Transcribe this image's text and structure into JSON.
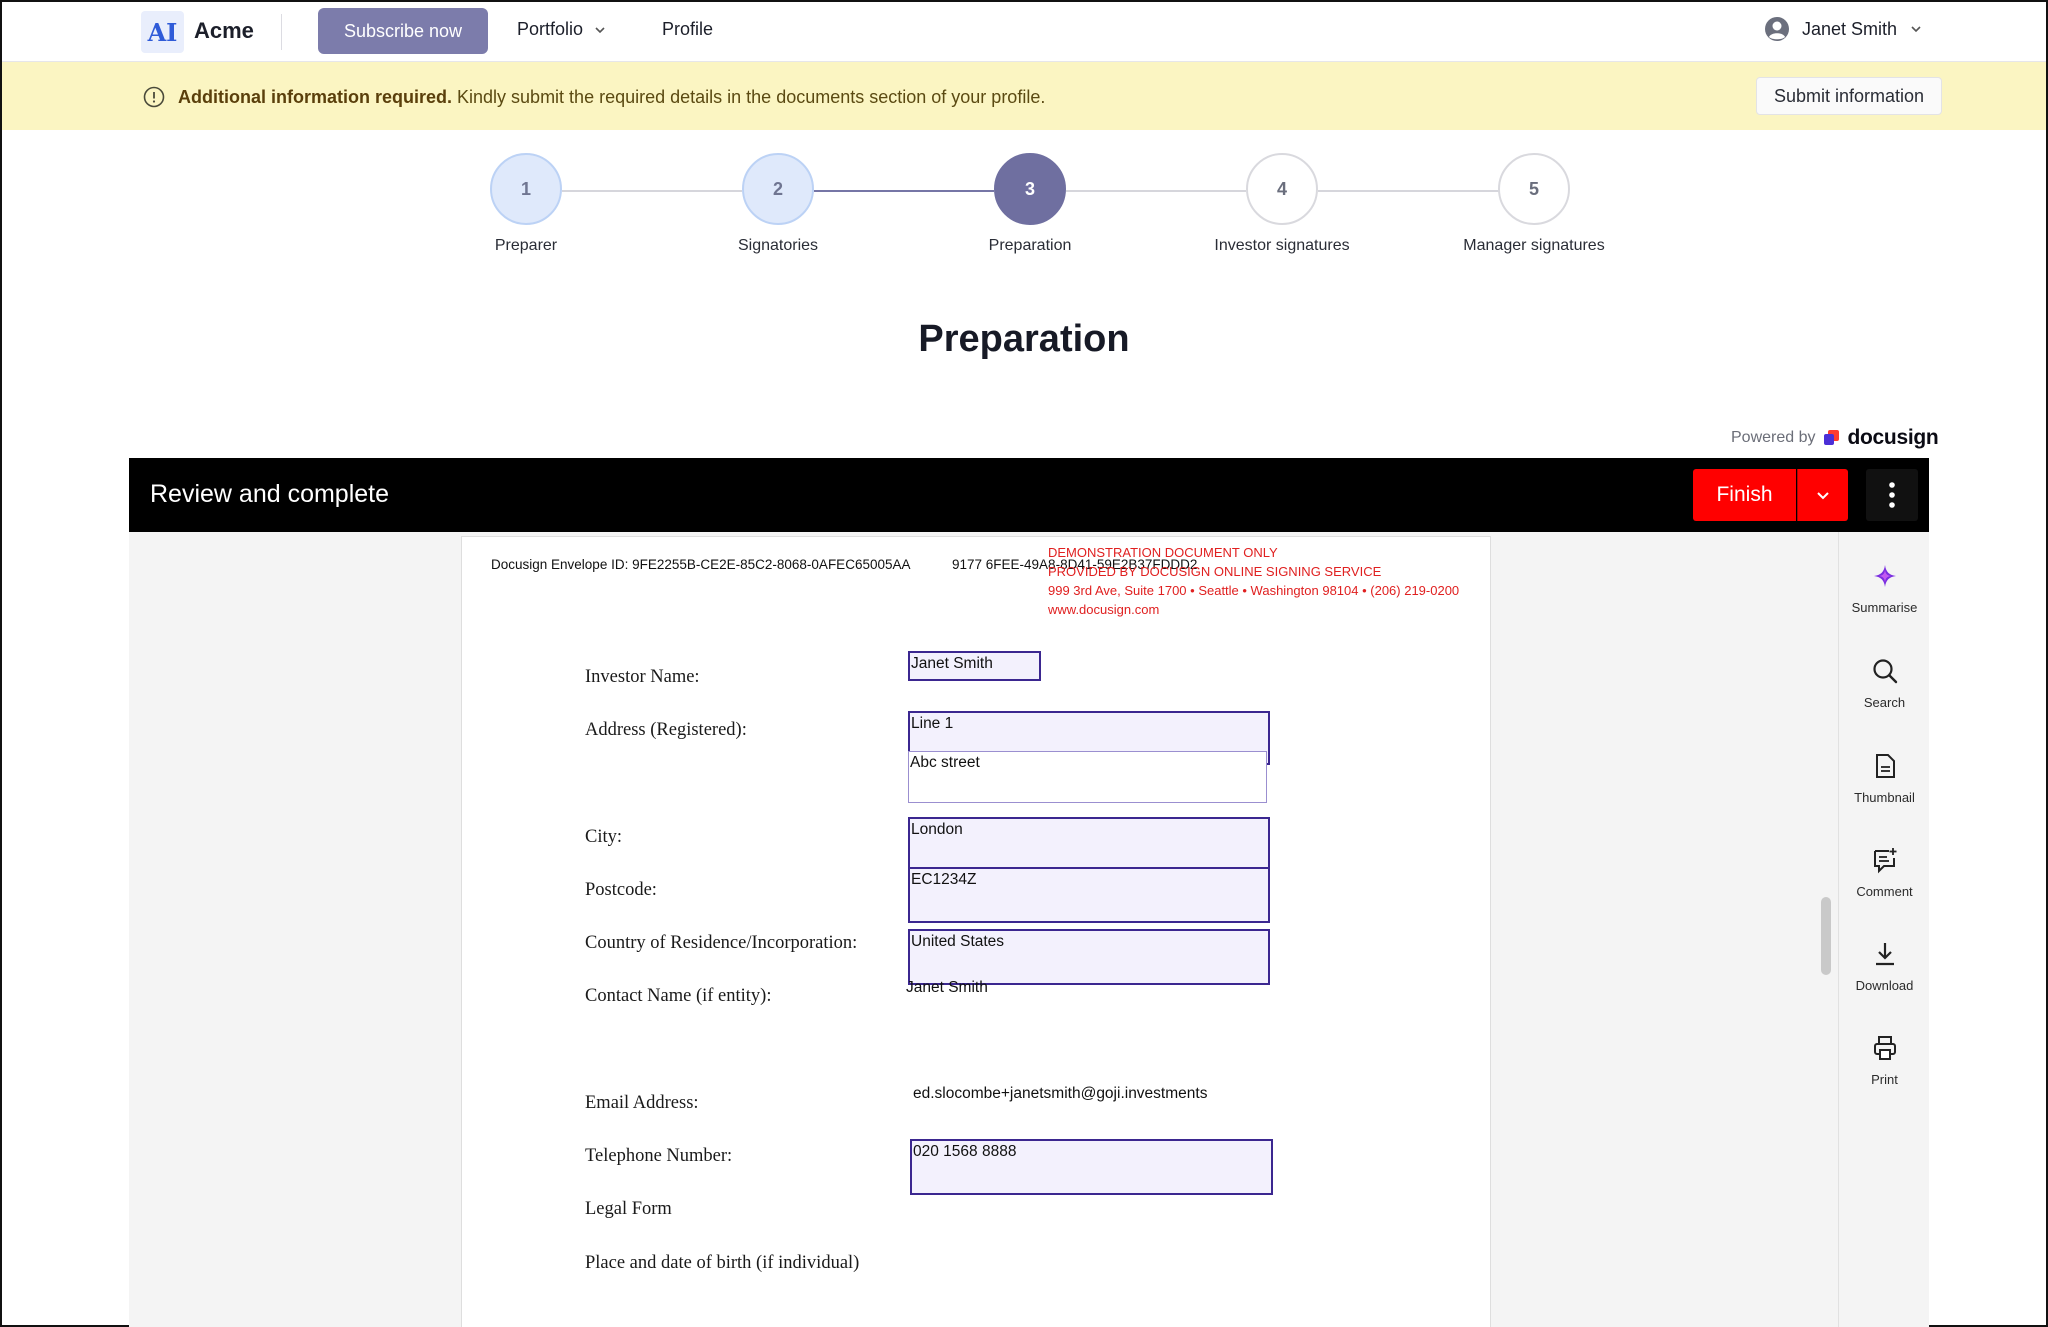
{
  "nav": {
    "logo": "AI",
    "brand": "Acme",
    "subscribe": "Subscribe now",
    "portfolio": "Portfolio",
    "profile": "Profile",
    "user": "Janet Smith"
  },
  "banner": {
    "title": "Additional information required.",
    "message": "Kindly submit the required details in the documents section of your profile.",
    "action": "Submit information"
  },
  "steps": [
    {
      "num": "1",
      "label": "Preparer",
      "state": "done"
    },
    {
      "num": "2",
      "label": "Signatories",
      "state": "done"
    },
    {
      "num": "3",
      "label": "Preparation",
      "state": "current"
    },
    {
      "num": "4",
      "label": "Investor signatures",
      "state": "todo"
    },
    {
      "num": "5",
      "label": "Manager signatures",
      "state": "todo"
    }
  ],
  "page_title": "Preparation",
  "docusign": {
    "powered_by": "Powered by",
    "brand": "docusign",
    "review_title": "Review and complete",
    "finish": "Finish"
  },
  "document": {
    "envelope_id": "Docusign Envelope ID: 9FE2255B-CE2E-85C2-8068-0AFEC65005AA",
    "envelope_id2": "9177 6FEE-49A8-8D41-59E2B37FDDD2",
    "demo_lines": [
      "DEMONSTRATION DOCUMENT ONLY",
      "PROVIDED BY DOCUSIGN ONLINE SIGNING SERVICE",
      "999 3rd Ave, Suite 1700  • Seattle • Washington 98104 • (206) 219-0200",
      "www.docusign.com"
    ],
    "labels": {
      "investor_name": "Investor Name:",
      "address": "Address (Registered):",
      "city": "City:",
      "postcode": "Postcode:",
      "country": "Country of Residence/Incorporation:",
      "contact": "Contact Name (if entity):",
      "email": "Email Address:",
      "telephone": "Telephone Number:",
      "legal_form": "Legal Form",
      "birth": "Place and date of birth (if individual)"
    },
    "values": {
      "investor_name": "Janet Smith",
      "address_line1": "Line 1",
      "address_line2": "Abc street",
      "city": "London",
      "postcode": "EC1234Z",
      "country": "United States",
      "contact": "Janet Smith",
      "email": "ed.slocombe+janetsmith@goji.investments",
      "telephone": "020 1568 8888"
    }
  },
  "tools": [
    {
      "label": "Summarise",
      "icon": "sparkle-icon"
    },
    {
      "label": "Search",
      "icon": "search-icon"
    },
    {
      "label": "Thumbnail",
      "icon": "document-icon"
    },
    {
      "label": "Comment",
      "icon": "comment-icon"
    },
    {
      "label": "Download",
      "icon": "download-icon"
    },
    {
      "label": "Print",
      "icon": "printer-icon"
    }
  ],
  "colors": {
    "accent": "#7c7cab",
    "banner": "#fbf5c2",
    "finish": "#ff0000",
    "field_border": "#3b2790"
  }
}
